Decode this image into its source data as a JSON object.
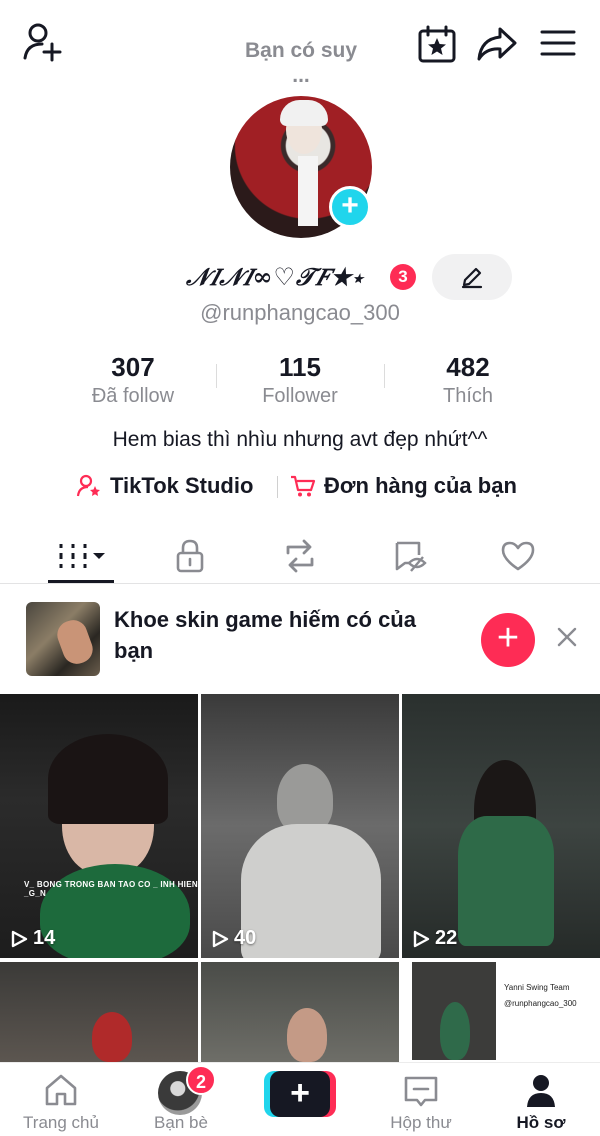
{
  "story_bubble": "Bạn có suy ...",
  "profile": {
    "display_name": "𝒩𝐼𝒩𝐼∞♡𝒯𝐹★⋆",
    "notification_count": "3",
    "username": "@runphangcao_300",
    "bio": "Hem bias thì nhìu nhưng avt đẹp nhứt^^"
  },
  "stats": [
    {
      "value": "307",
      "label": "Đã follow"
    },
    {
      "value": "115",
      "label": "Follower"
    },
    {
      "value": "482",
      "label": "Thích"
    }
  ],
  "links": {
    "studio": "TikTok Studio",
    "orders": "Đơn hàng của bạn"
  },
  "promo": {
    "text": "Khoe skin game hiếm có của bạn"
  },
  "videos": [
    {
      "views": "14",
      "caption": "V_ BONG TRONG BAN TAO CO _ INH HIEN _G_N"
    },
    {
      "views": "40"
    },
    {
      "views": "22"
    },
    {
      "views": ""
    },
    {
      "views": ""
    },
    {
      "views": "",
      "caption_lines": [
        "Yanni Swing Team",
        "@runphangcao_300"
      ]
    }
  ],
  "bottom_nav": [
    {
      "label": "Trang chủ"
    },
    {
      "label": "Bạn bè",
      "badge": "2"
    },
    {
      "label": ""
    },
    {
      "label": "Hộp thư"
    },
    {
      "label": "Hồ sơ"
    }
  ],
  "colors": {
    "accent": "#fe2c55",
    "cyan": "#20d5ec",
    "text": "#161823",
    "muted": "#8a8b91"
  },
  "icons": [
    "add-user-icon",
    "calendar-star-icon",
    "share-icon",
    "menu-icon",
    "edit-pencil-icon",
    "grid-videos-icon",
    "lock-icon",
    "repost-icon",
    "tag-hidden-icon",
    "heart-icon",
    "close-icon",
    "play-icon",
    "home-icon",
    "inbox-icon",
    "profile-icon"
  ]
}
